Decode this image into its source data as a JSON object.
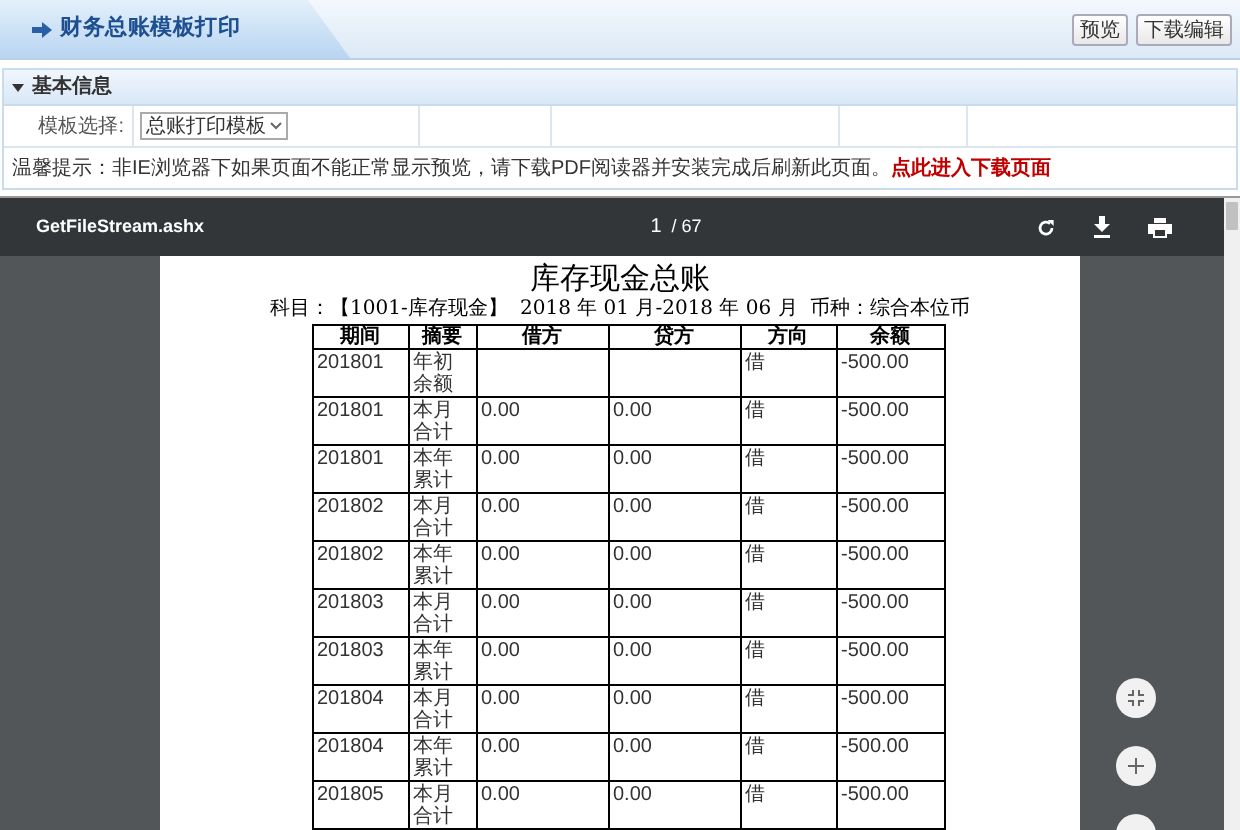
{
  "header": {
    "title": "财务总账模板打印",
    "buttons": [
      "预览",
      "下载编辑"
    ]
  },
  "section": {
    "title": "基本信息",
    "expanded": true
  },
  "form": {
    "label": "模板选择:",
    "select_value": "总账打印模板"
  },
  "hint": {
    "text": "温馨提示：非IE浏览器下如果页面不能正常显示预览，请下载PDF阅读器并安装完成后刷新此页面。",
    "link": "点此进入下载页面"
  },
  "viewer": {
    "filename": "GetFileStream.ashx",
    "page": "1",
    "page_count": "/ 67",
    "document": {
      "title": "库存现金总账",
      "subject": "科目：【1001-库存现金】",
      "period": "2018 年 01 月-2018 年 06 月",
      "currency": "币种：综合本位币",
      "columns": [
        "期间",
        "摘要",
        "借方",
        "贷方",
        "方向",
        "余额"
      ],
      "rows": [
        [
          "201801",
          "年初余额",
          "",
          "",
          "借",
          "-500.00"
        ],
        [
          "201801",
          "本月合计",
          "0.00",
          "0.00",
          "借",
          "-500.00"
        ],
        [
          "201801",
          "本年累计",
          "0.00",
          "0.00",
          "借",
          "-500.00"
        ],
        [
          "201802",
          "本月合计",
          "0.00",
          "0.00",
          "借",
          "-500.00"
        ],
        [
          "201802",
          "本年累计",
          "0.00",
          "0.00",
          "借",
          "-500.00"
        ],
        [
          "201803",
          "本月合计",
          "0.00",
          "0.00",
          "借",
          "-500.00"
        ],
        [
          "201803",
          "本年累计",
          "0.00",
          "0.00",
          "借",
          "-500.00"
        ],
        [
          "201804",
          "本月合计",
          "0.00",
          "0.00",
          "借",
          "-500.00"
        ],
        [
          "201804",
          "本年累计",
          "0.00",
          "0.00",
          "借",
          "-500.00"
        ],
        [
          "201805",
          "本月合计",
          "0.00",
          "0.00",
          "借",
          "-500.00"
        ]
      ]
    }
  }
}
